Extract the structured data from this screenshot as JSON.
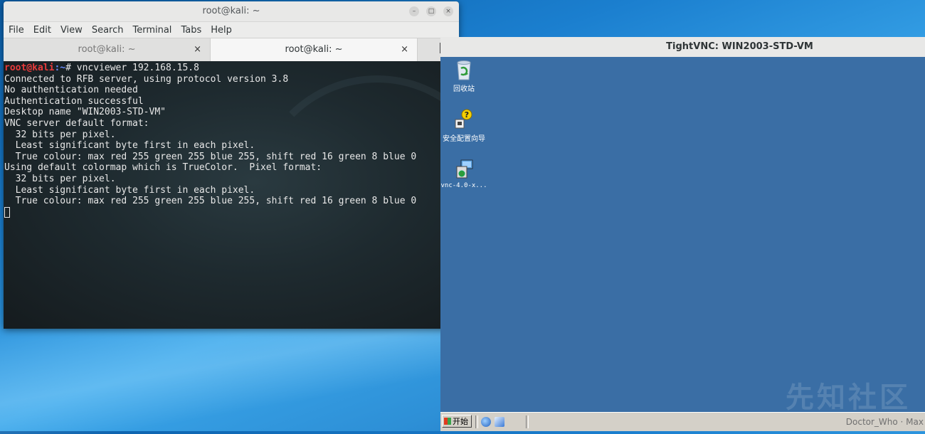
{
  "terminal": {
    "window_title": "root@kali: ~",
    "menu": [
      "File",
      "Edit",
      "View",
      "Search",
      "Terminal",
      "Tabs",
      "Help"
    ],
    "tabs": [
      {
        "label": "root@kali: ~",
        "active": false
      },
      {
        "label": "root@kali: ~",
        "active": true
      }
    ],
    "prompt_user": "root@kali",
    "prompt_path": ":~",
    "prompt_symbol": "# ",
    "command": "vncviewer 192.168.15.8",
    "output": [
      "Connected to RFB server, using protocol version 3.8",
      "No authentication needed",
      "Authentication successful",
      "Desktop name \"WIN2003-STD-VM\"",
      "VNC server default format:",
      "  32 bits per pixel.",
      "  Least significant byte first in each pixel.",
      "  True colour: max red 255 green 255 blue 255, shift red 16 green 8 blue 0",
      "Using default colormap which is TrueColor.  Pixel format:",
      "  32 bits per pixel.",
      "  Least significant byte first in each pixel.",
      "  True colour: max red 255 green 255 blue 255, shift red 16 green 8 blue 0"
    ],
    "minimize_glyph": "–",
    "maximize_glyph": "□",
    "close_glyph": "×",
    "tab_close_glyph": "×",
    "new_tab_glyph": "+"
  },
  "vnc": {
    "window_title": "TightVNC: WIN2003-STD-VM",
    "desktop_icons": [
      {
        "label": "回收站",
        "icon": "recycle-bin-icon"
      },
      {
        "label": "安全配置向导",
        "icon": "security-wizard-icon"
      },
      {
        "label": "vnc-4.0-x...",
        "icon": "installer-icon"
      }
    ],
    "start_label": "开始",
    "watermark": "先知社区",
    "author": "Doctor_Who · Max"
  },
  "colors": {
    "prompt_user": "#e83b3b",
    "win_desktop": "#3a6ea5",
    "taskbar": "#d4d0c8"
  }
}
